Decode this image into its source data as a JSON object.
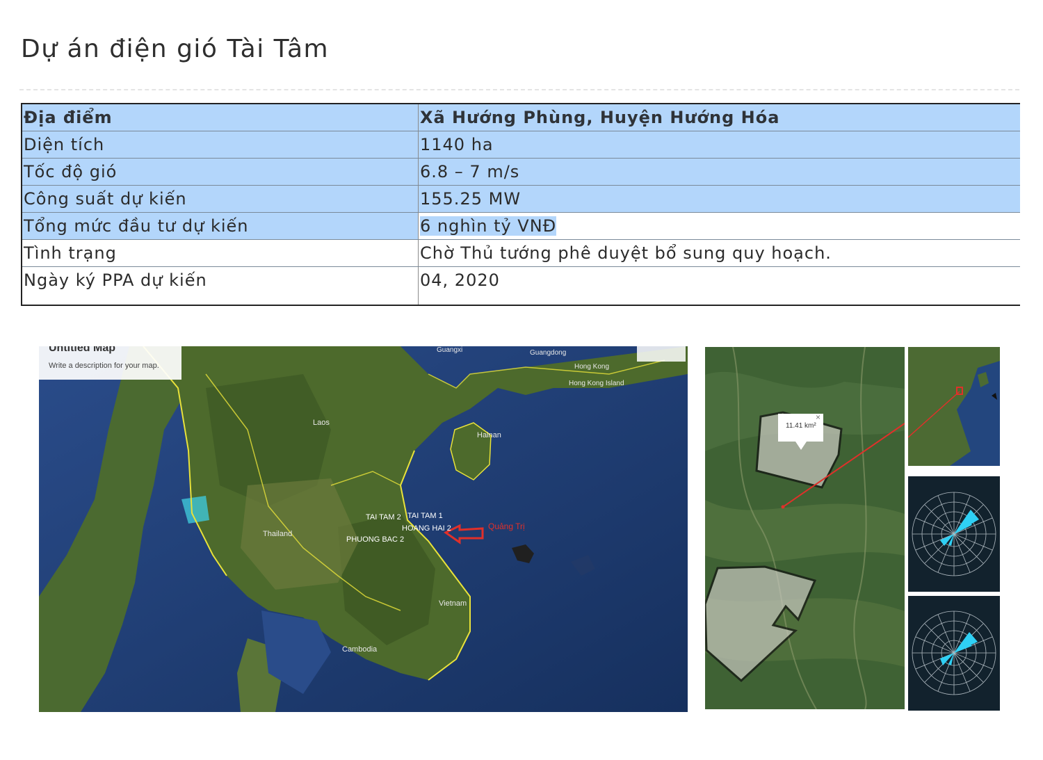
{
  "page": {
    "title": "Dự án điện gió Tài Tâm"
  },
  "table": {
    "rows": [
      {
        "label": "Địa điểm",
        "value": "Xã Hướng Phùng, Huyện Hướng Hóa"
      },
      {
        "label": "Diện tích",
        "value": "1140 ha"
      },
      {
        "label": "Tốc độ gió",
        "value": "6.8 – 7 m/s"
      },
      {
        "label": "Công suất dự kiến",
        "value": "155.25 MW"
      },
      {
        "label": "Tổng mức đầu tư dự kiến",
        "value": "6 nghìn tỷ VNĐ"
      },
      {
        "label": "Tình trạng",
        "value": "Chờ Thủ tướng phê duyệt bổ sung quy hoạch."
      },
      {
        "label": "Ngày ký PPA dự kiến",
        "value": "04, 2020"
      }
    ]
  },
  "map": {
    "panel_title": "Untitled Map",
    "panel_description": "Write a description for your map.",
    "places": {
      "guangxi": "Guangxi",
      "guangdong": "Guangdong",
      "hong_kong": "Hong Kong",
      "hong_kong_island": "Hong Kong Island",
      "laos": "Laos",
      "hainan": "Hainan",
      "thailand": "Thailand",
      "vietnam": "Vietnam",
      "cambodia": "Cambodia",
      "quang_tri": "Quảng Trị"
    },
    "project_labels": [
      "TAI TAM 2",
      "TAI TAM 1",
      "HOANG HAI 2",
      "PHUONG BAC 2"
    ]
  },
  "site_map": {
    "area_label": "11.41 km²",
    "close_glyph": "×"
  },
  "colors": {
    "highlight": "#b3d6fb",
    "sea": "#1f3f7a",
    "land": "#4d6a2c",
    "border_line": "#e9e23a",
    "marker": "#e0302a",
    "rose_bg": "#12222d",
    "rose_fill": "#2fd0f5"
  }
}
